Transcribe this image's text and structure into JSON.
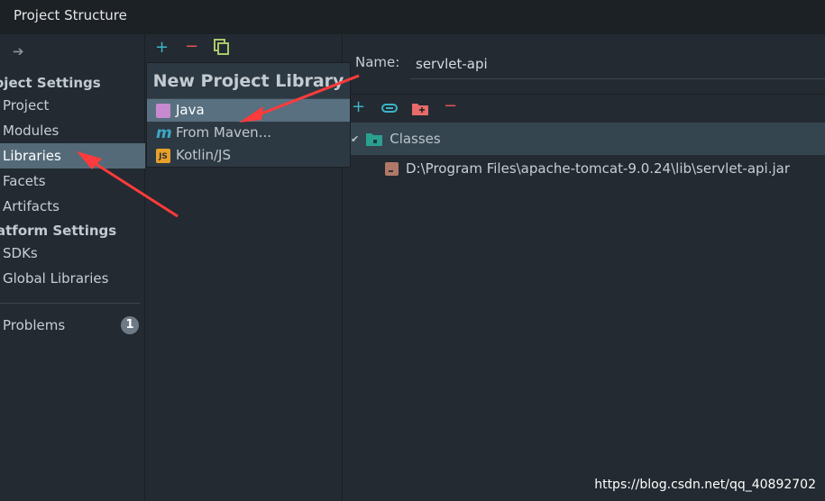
{
  "window": {
    "title": "Project Structure"
  },
  "sidebar": {
    "project_settings": "oject Settings",
    "platform_settings": "atform Settings",
    "items": [
      {
        "label": "Project"
      },
      {
        "label": "Modules"
      },
      {
        "label": "Libraries"
      },
      {
        "label": "Facets"
      },
      {
        "label": "Artifacts"
      },
      {
        "label": "SDKs"
      },
      {
        "label": "Global Libraries"
      }
    ],
    "problems": {
      "label": "Problems",
      "count": "1"
    }
  },
  "popup": {
    "title": "New Project Library",
    "items": [
      {
        "label": "Java",
        "icon": "java-library-icon"
      },
      {
        "label": "From Maven...",
        "icon": "maven-icon"
      },
      {
        "label": "Kotlin/JS",
        "icon": "js-icon"
      }
    ]
  },
  "detail": {
    "name_label": "Name:",
    "name_value": "servlet-api",
    "classes_label": "Classes",
    "jar_path": "D:\\Program Files\\apache-tomcat-9.0.24\\lib\\servlet-api.jar"
  },
  "watermark": "https://blog.csdn.net/qq_40892702",
  "colors": {
    "accent_add": "#3cb4c8",
    "remove": "#e05555",
    "selection": "#556a78",
    "arrow": "#ff3b3b"
  }
}
